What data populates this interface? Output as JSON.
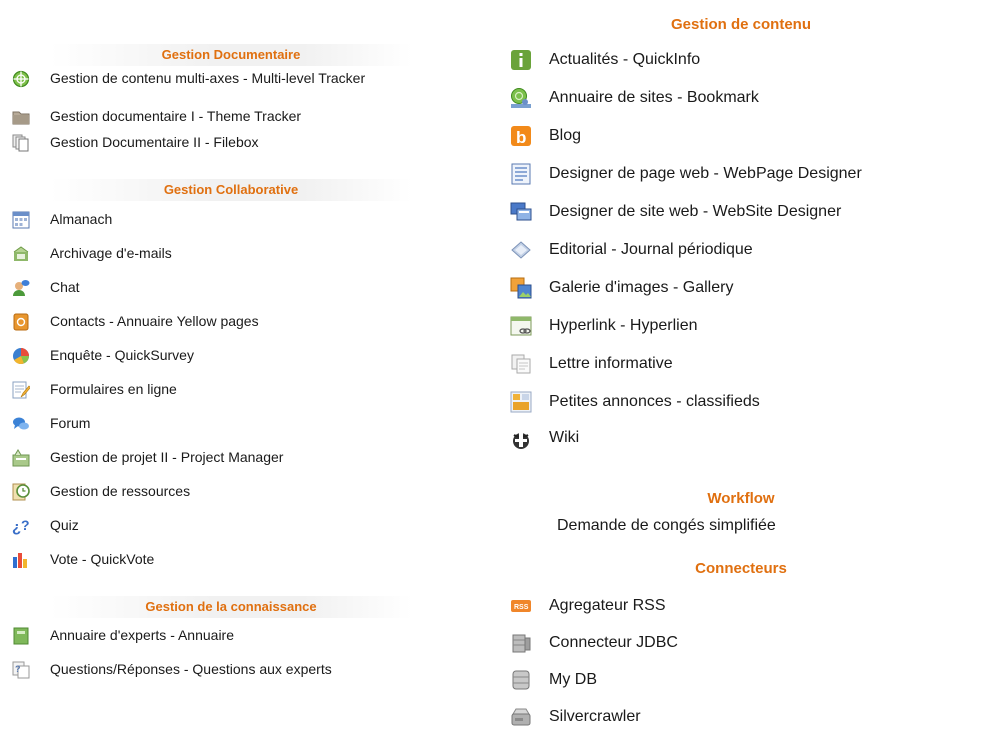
{
  "left": {
    "sections": [
      {
        "title": "Gestion Documentaire",
        "items": [
          {
            "label": "Gestion de contenu multi-axes - Multi-level Tracker",
            "icon": "compass-icon"
          },
          {
            "label": "Gestion documentaire I - Theme Tracker",
            "icon": "folder-icon"
          },
          {
            "label": "Gestion Documentaire II - Filebox",
            "icon": "documents-icon"
          }
        ]
      },
      {
        "title": "Gestion Collaborative",
        "items": [
          {
            "label": "Almanach",
            "icon": "calendar-icon"
          },
          {
            "label": "Archivage d'e-mails",
            "icon": "mailbox-icon"
          },
          {
            "label": "Chat",
            "icon": "chat-user-icon"
          },
          {
            "label": "Contacts - Annuaire Yellow pages",
            "icon": "address-book-icon"
          },
          {
            "label": "Enquête - QuickSurvey",
            "icon": "pie-chart-icon"
          },
          {
            "label": "Formulaires en ligne",
            "icon": "form-pencil-icon"
          },
          {
            "label": "Forum",
            "icon": "speech-bubbles-icon"
          },
          {
            "label": "Gestion de projet II - Project Manager",
            "icon": "project-icon"
          },
          {
            "label": "Gestion de ressources",
            "icon": "resource-clock-icon"
          },
          {
            "label": "Quiz",
            "icon": "question-icon"
          },
          {
            "label": "Vote - QuickVote",
            "icon": "bar-chart-icon"
          }
        ]
      },
      {
        "title": "Gestion de la connaissance",
        "items": [
          {
            "label": "Annuaire d'experts - Annuaire",
            "icon": "expert-book-icon"
          },
          {
            "label": "Questions/Réponses - Questions aux experts",
            "icon": "faq-icon"
          }
        ]
      }
    ]
  },
  "right": {
    "sections": [
      {
        "title": "Gestion de contenu",
        "items": [
          {
            "label": "Actualités - QuickInfo",
            "icon": "info-icon"
          },
          {
            "label": "Annuaire de sites - Bookmark",
            "icon": "globe-user-icon"
          },
          {
            "label": "Blog",
            "icon": "blog-icon"
          },
          {
            "label": "Designer de page web - WebPage Designer",
            "icon": "page-designer-icon"
          },
          {
            "label": "Designer de site web - WebSite Designer",
            "icon": "site-designer-icon"
          },
          {
            "label": "Editorial - Journal périodique",
            "icon": "diamond-icon"
          },
          {
            "label": "Galerie d'images - Gallery",
            "icon": "gallery-icon"
          },
          {
            "label": "Hyperlink - Hyperlien",
            "icon": "hyperlink-icon"
          },
          {
            "label": "Lettre informative",
            "icon": "newsletter-icon"
          },
          {
            "label": "Petites annonces - classifieds",
            "icon": "classifieds-icon"
          },
          {
            "label": "Wiki",
            "icon": "wiki-icon"
          }
        ]
      },
      {
        "title": "Workflow",
        "items": [
          {
            "label": "Demande de congés simplifiée",
            "icon": ""
          }
        ]
      },
      {
        "title": "Connecteurs",
        "items": [
          {
            "label": "Agregateur RSS",
            "icon": "rss-icon"
          },
          {
            "label": "Connecteur JDBC",
            "icon": "database-icon"
          },
          {
            "label": "My DB",
            "icon": "db-stack-icon"
          },
          {
            "label": "Silvercrawler",
            "icon": "drive-icon"
          }
        ]
      }
    ]
  },
  "colors": {
    "section_title": "#e07010",
    "text": "#1a1a1a",
    "header_band": "#f1f1f1"
  }
}
